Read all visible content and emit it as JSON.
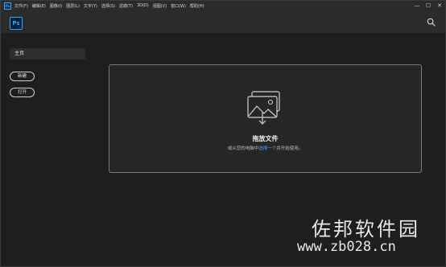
{
  "app": {
    "icon_label": "Ps"
  },
  "menubar": {
    "items": [
      "文件(F)",
      "编辑(E)",
      "图像(I)",
      "图层(L)",
      "文字(Y)",
      "选择(S)",
      "滤镜(T)",
      "3D(D)",
      "视图(V)",
      "窗口(W)",
      "帮助(H)"
    ]
  },
  "window_controls": {
    "minimize": "—",
    "maximize": "☐",
    "close": "✕"
  },
  "header": {
    "logo": "Ps"
  },
  "sidebar": {
    "home_label": "主页",
    "new_label": "新建",
    "open_label": "打开"
  },
  "dropzone": {
    "title": "拖放文件",
    "subtitle_prefix": "或从您的电脑中",
    "subtitle_link": "选择一个",
    "subtitle_suffix": "并开始使用。"
  },
  "watermark": {
    "text_cn": "佐邦软件园",
    "url": "www.zb028.cn"
  },
  "colors": {
    "accent": "#31a8ff",
    "link": "#4ea3ff",
    "background": "#1e1e1e",
    "panel": "#2b2b2b"
  }
}
